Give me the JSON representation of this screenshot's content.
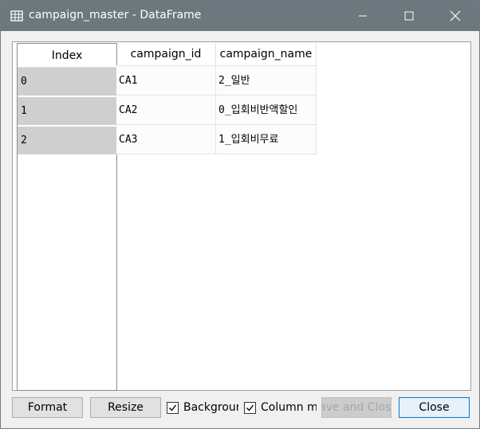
{
  "window": {
    "title": "campaign_master - DataFrame",
    "icons": {
      "app": "table-grid-icon",
      "minimize": "minimize-icon",
      "maximize": "maximize-icon",
      "close": "close-icon"
    }
  },
  "table": {
    "index_header": "Index",
    "columns": [
      "campaign_id",
      "campaign_name"
    ],
    "rows": [
      {
        "index": "0",
        "campaign_id": "CA1",
        "campaign_name": "2_일반"
      },
      {
        "index": "1",
        "campaign_id": "CA2",
        "campaign_name": "0_입회비반액할인"
      },
      {
        "index": "2",
        "campaign_id": "CA3",
        "campaign_name": "1_입회비무료"
      }
    ]
  },
  "footer": {
    "format_label": "Format",
    "resize_label": "Resize",
    "background_label": "Backgrour",
    "background_checked": true,
    "column_minmax_label": "Column mi",
    "column_minmax_checked": true,
    "save_close_label": "ave and Clos",
    "close_label": "Close"
  },
  "colors": {
    "titlebar": "#6b787e",
    "index_cell": "#cfcfcf",
    "close_border": "#0078d7"
  }
}
